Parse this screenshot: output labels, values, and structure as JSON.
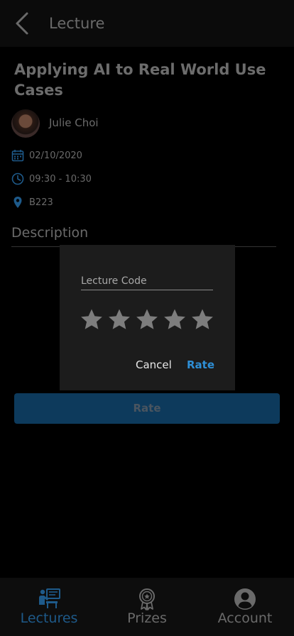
{
  "header": {
    "title": "Lecture"
  },
  "lecture": {
    "title": "Applying AI to Real World Use Cases",
    "speaker": "Julie Choi",
    "date": "02/10/2020",
    "time": "09:30 - 10:30",
    "room": "B223",
    "description_label": "Description"
  },
  "rate_button": {
    "label": "Rate"
  },
  "dialog": {
    "code_placeholder": "Lecture Code",
    "rating": 0,
    "max_stars": 5,
    "cancel_label": "Cancel",
    "rate_label": "Rate"
  },
  "nav": {
    "items": [
      {
        "label": "Lectures",
        "icon": "lectures-icon",
        "active": true
      },
      {
        "label": "Prizes",
        "icon": "prize-icon",
        "active": false
      },
      {
        "label": "Account",
        "icon": "account-icon",
        "active": false
      }
    ]
  },
  "colors": {
    "accent": "#2e8fd6",
    "nav_active": "#1e5a8a",
    "nav_inactive": "#6a6a6a",
    "info_icon": "#1e5a8a"
  }
}
